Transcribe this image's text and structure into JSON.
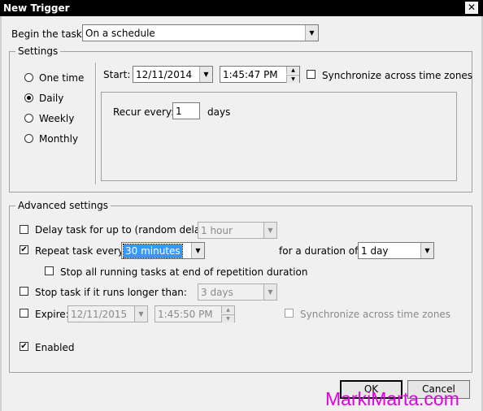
{
  "window": {
    "title": "New Trigger",
    "close_glyph": "✕"
  },
  "begin": {
    "label": "Begin the task:",
    "value": "On a schedule"
  },
  "settings": {
    "legend": "Settings",
    "radios": [
      {
        "label": "One time",
        "checked": false
      },
      {
        "label": "Daily",
        "checked": true
      },
      {
        "label": "Weekly",
        "checked": false
      },
      {
        "label": "Monthly",
        "checked": false
      }
    ],
    "start_label": "Start:",
    "start_date": "12/11/2014",
    "start_time": "1:45:47 PM",
    "sync_label": "Synchronize across time zones",
    "sync_checked": false,
    "recur_label": "Recur every:",
    "recur_value": "1",
    "recur_unit": "days"
  },
  "advanced": {
    "legend": "Advanced settings",
    "delay": {
      "label": "Delay task for up to (random delay):",
      "value": "1 hour",
      "checked": false
    },
    "repeat": {
      "label": "Repeat task every:",
      "value": "30 minutes",
      "checked": true
    },
    "duration": {
      "label": "for a duration of:",
      "value": "1 day"
    },
    "stop_running": {
      "label": "Stop all running tasks at end of repetition duration",
      "checked": false
    },
    "stop_longer": {
      "label": "Stop task if it runs longer than:",
      "value": "3 days",
      "checked": false
    },
    "expire": {
      "label": "Expire:",
      "date": "12/11/2015",
      "time": "1:45:50 PM",
      "checked": false
    },
    "expire_sync": {
      "label": "Synchronize across time zones",
      "checked": false
    },
    "enabled": {
      "label": "Enabled",
      "checked": true
    }
  },
  "buttons": {
    "ok": "OK",
    "cancel": "Cancel"
  },
  "watermark": "MarkiMarta.com",
  "icons": {
    "dropdown": "chevron-down-icon",
    "spin_up": "spin-up-icon",
    "spin_down": "spin-down-icon",
    "check": "checkmark-icon"
  }
}
